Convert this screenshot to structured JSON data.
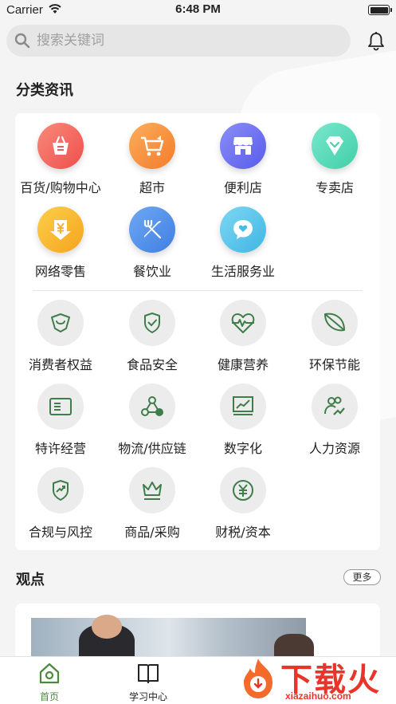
{
  "status_bar": {
    "carrier": "Carrier",
    "time": "6:48 PM"
  },
  "search": {
    "placeholder": "搜索关键词"
  },
  "category_section": {
    "title": "分类资讯"
  },
  "categories": [
    {
      "label": "百货/购物中心",
      "icon": "shopping-basket-icon",
      "color": "#f2675f"
    },
    {
      "label": "超市",
      "icon": "shopping-cart-icon",
      "color": "#f7913a"
    },
    {
      "label": "便利店",
      "icon": "store-icon",
      "color": "#6a6ff0"
    },
    {
      "label": "专卖店",
      "icon": "diamond-icon",
      "color": "#5dd9b8"
    },
    {
      "label": "网络零售",
      "icon": "yuan-download-icon",
      "color": "#f7b52a"
    },
    {
      "label": "餐饮业",
      "icon": "fork-knife-icon",
      "color": "#4d8de8"
    },
    {
      "label": "生活服务业",
      "icon": "heart-chat-icon",
      "color": "#55c3e8"
    }
  ],
  "topics": [
    {
      "label": "消费者权益",
      "icon": "shield-smile-icon"
    },
    {
      "label": "食品安全",
      "icon": "shield-check-icon"
    },
    {
      "label": "健康营养",
      "icon": "heart-pulse-icon"
    },
    {
      "label": "环保节能",
      "icon": "leaf-icon"
    },
    {
      "label": "特许经营",
      "icon": "id-card-icon"
    },
    {
      "label": "物流/供应链",
      "icon": "network-nodes-icon"
    },
    {
      "label": "数字化",
      "icon": "chart-monitor-icon"
    },
    {
      "label": "人力资源",
      "icon": "people-growth-icon"
    },
    {
      "label": "合规与风控",
      "icon": "shield-trend-icon"
    },
    {
      "label": "商品/采购",
      "icon": "crown-icon"
    },
    {
      "label": "财税/资本",
      "icon": "yuan-circle-icon"
    }
  ],
  "opinion_section": {
    "title": "观点",
    "more_label": "更多"
  },
  "tab_bar": {
    "tabs": [
      {
        "label": "首页",
        "icon": "home-icon",
        "active": true
      },
      {
        "label": "学习中心",
        "icon": "book-icon",
        "active": false
      }
    ]
  },
  "watermark": {
    "text": "下载火",
    "subtext": "xiazaihuo.com"
  },
  "colors": {
    "accent": "#4d8a3c",
    "icon_green": "#3f7d4a"
  }
}
